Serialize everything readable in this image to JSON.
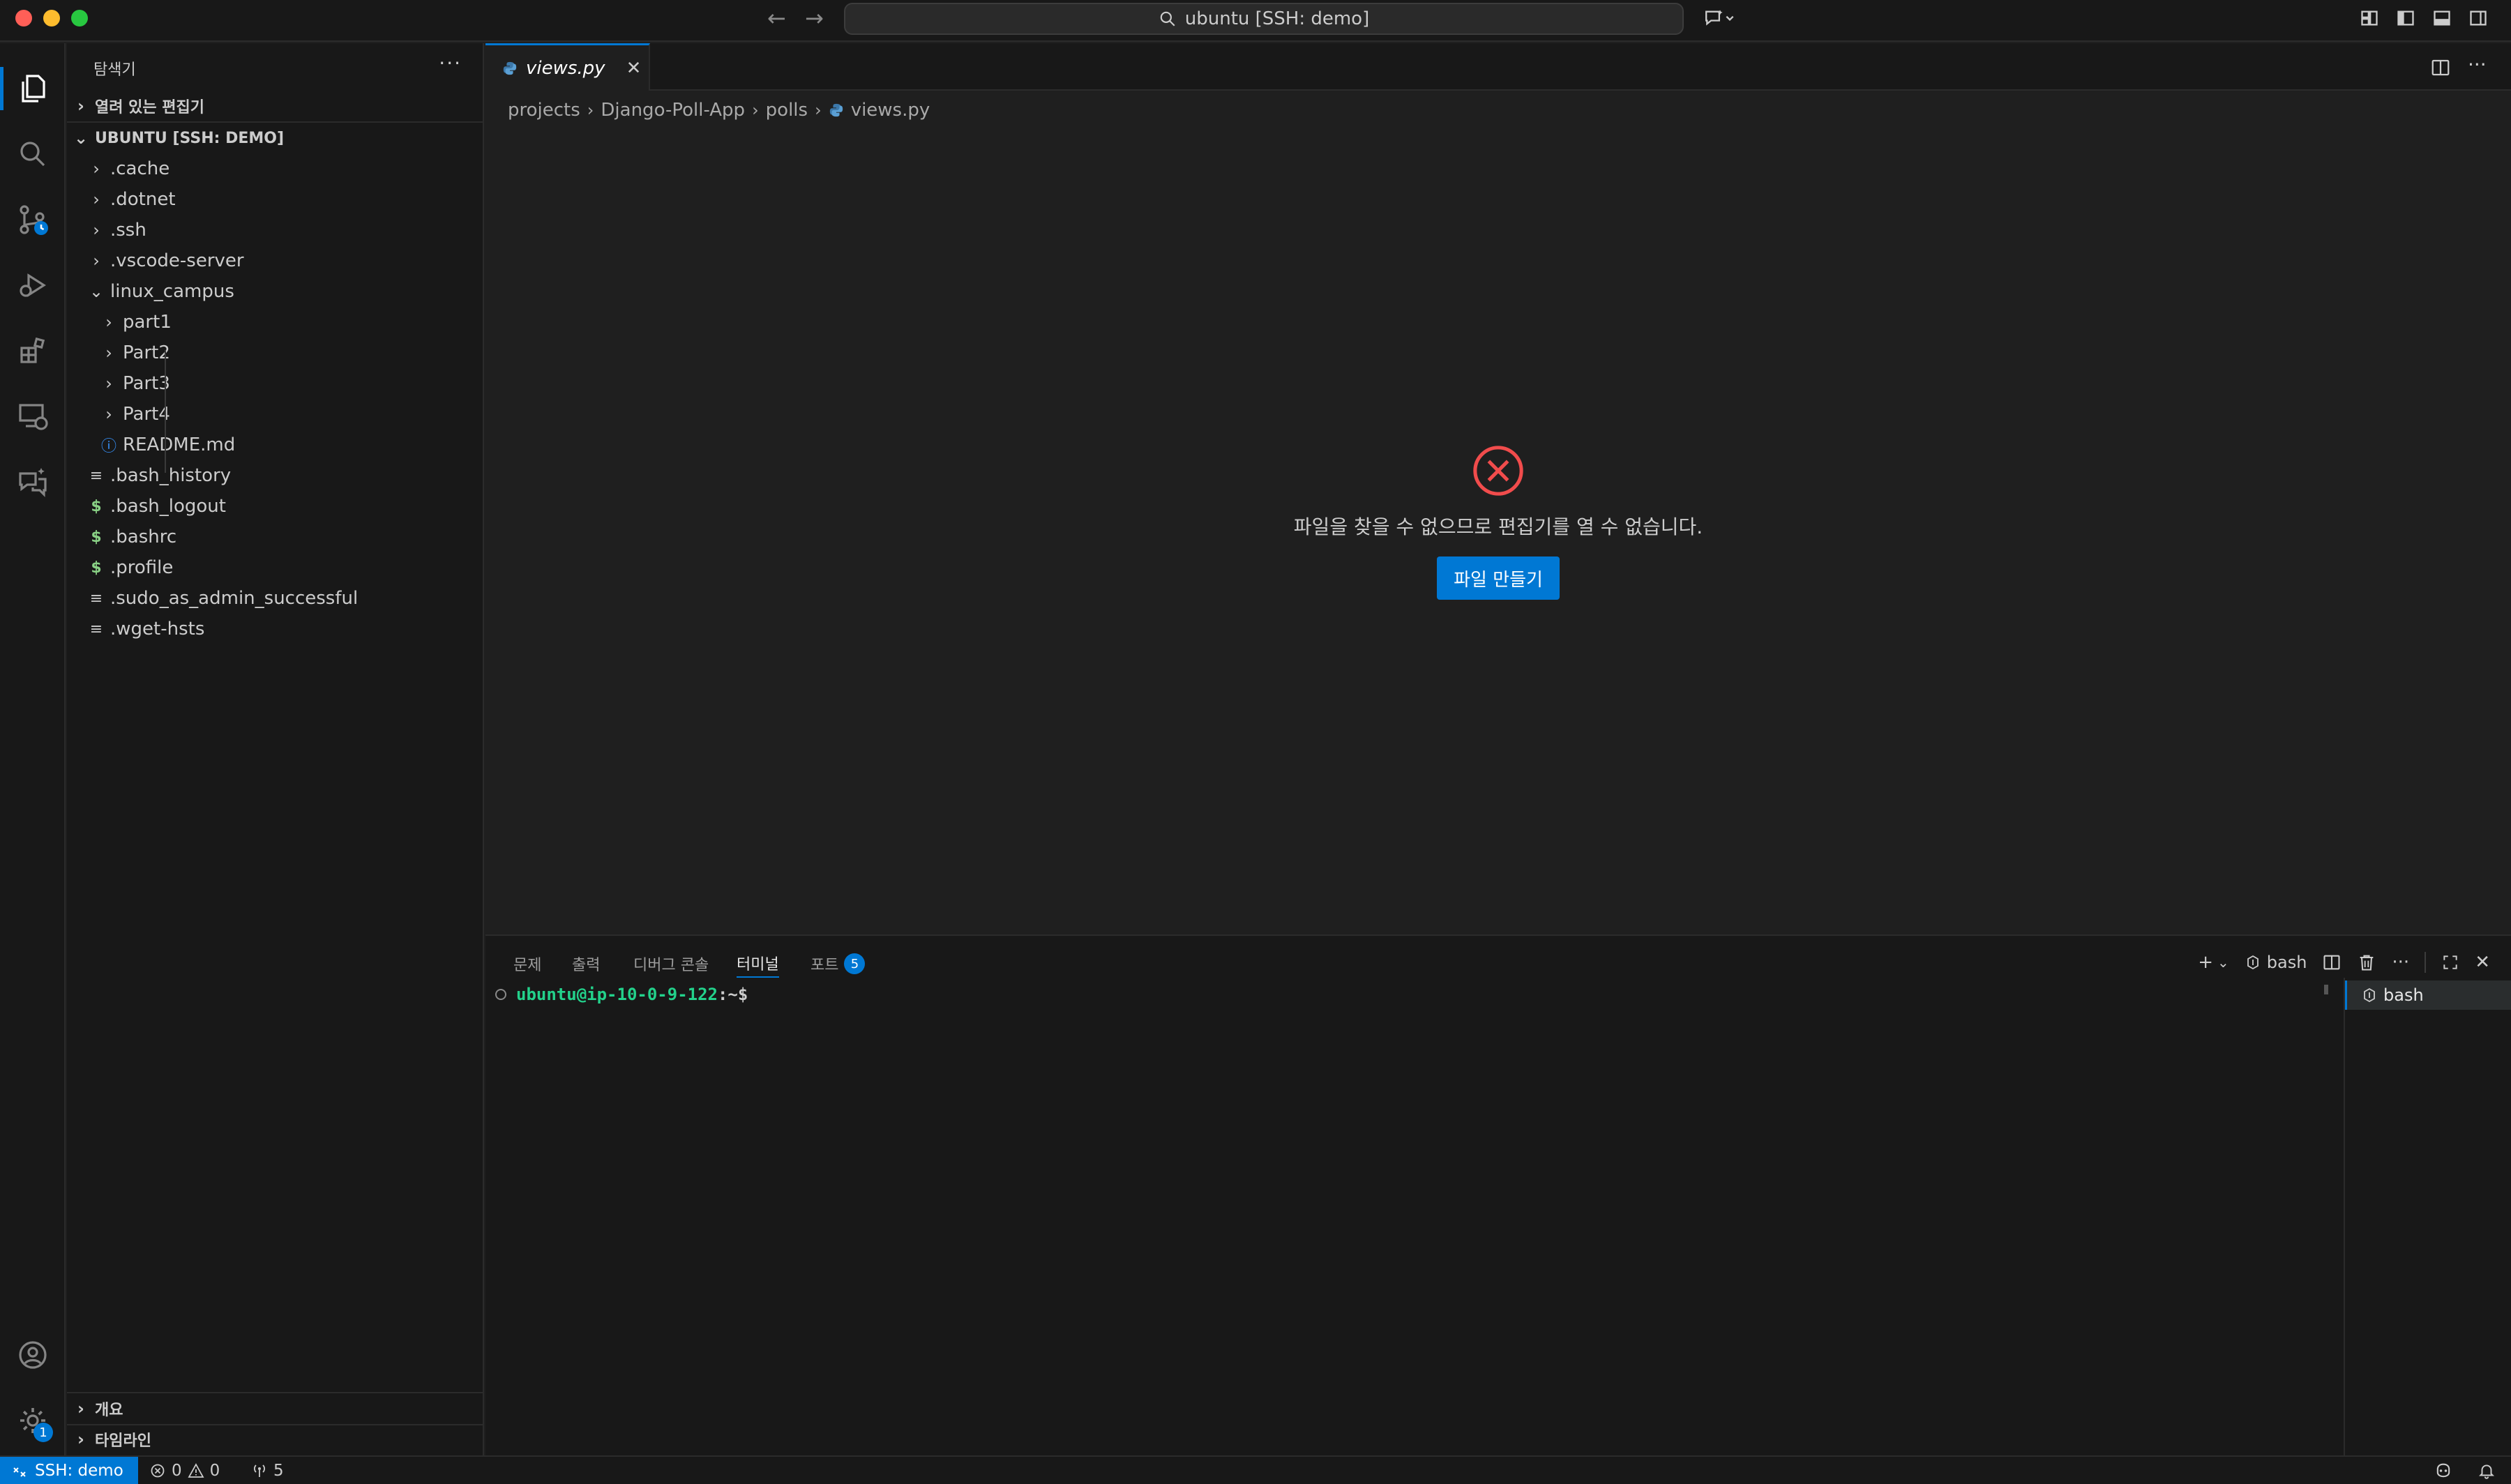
{
  "window": {
    "search_text": "ubuntu [SSH: demo]"
  },
  "sidebar": {
    "title": "탐색기",
    "more": "···",
    "open_editors": "열려 있는 편집기",
    "workspace": "UBUNTU [SSH: DEMO]",
    "tree": [
      {
        "label": ".cache",
        "kind": "folder",
        "depth": 1
      },
      {
        "label": ".dotnet",
        "kind": "folder",
        "depth": 1
      },
      {
        "label": ".ssh",
        "kind": "folder",
        "depth": 1
      },
      {
        "label": ".vscode-server",
        "kind": "folder",
        "depth": 1
      },
      {
        "label": "linux_campus",
        "kind": "folder-open",
        "depth": 1
      },
      {
        "label": "part1",
        "kind": "folder",
        "depth": 2
      },
      {
        "label": "Part2",
        "kind": "folder",
        "depth": 2
      },
      {
        "label": "Part3",
        "kind": "folder",
        "depth": 2
      },
      {
        "label": "Part4",
        "kind": "folder",
        "depth": 2
      },
      {
        "label": "README.md",
        "kind": "info-file",
        "depth": 2
      },
      {
        "label": ".bash_history",
        "kind": "text-file",
        "depth": 1
      },
      {
        "label": ".bash_logout",
        "kind": "shell-file",
        "depth": 1
      },
      {
        "label": ".bashrc",
        "kind": "shell-file",
        "depth": 1
      },
      {
        "label": ".profile",
        "kind": "shell-file",
        "depth": 1
      },
      {
        "label": ".sudo_as_admin_successful",
        "kind": "text-file",
        "depth": 1
      },
      {
        "label": ".wget-hsts",
        "kind": "text-file",
        "depth": 1
      }
    ],
    "outline": "개요",
    "timeline": "타임라인"
  },
  "editor": {
    "tab_label": "views.py",
    "breadcrumb": [
      "projects",
      "Django-Poll-App",
      "polls",
      "views.py"
    ],
    "error_message": "파일을 찾을 수 없으므로 편집기를 열 수 없습니다.",
    "create_file_button": "파일 만들기"
  },
  "panel": {
    "tabs": [
      {
        "label": "문제"
      },
      {
        "label": "출력"
      },
      {
        "label": "디버그 콘솔"
      },
      {
        "label": "터미널",
        "active": true
      },
      {
        "label": "포트",
        "badge": "5"
      }
    ],
    "shell_label": "bash",
    "prompt_user": "ubuntu@ip-10-0-9-122",
    "prompt_rest": ":~$",
    "terminal_list_item": "bash"
  },
  "statusbar": {
    "remote": "SSH: demo",
    "errors": "0",
    "warnings": "0",
    "ports": "5"
  },
  "activitybar": {
    "settings_badge": "1"
  },
  "colors": {
    "accent": "#0078d4",
    "error": "#f14c4c",
    "prompt_green": "#23d18b"
  }
}
